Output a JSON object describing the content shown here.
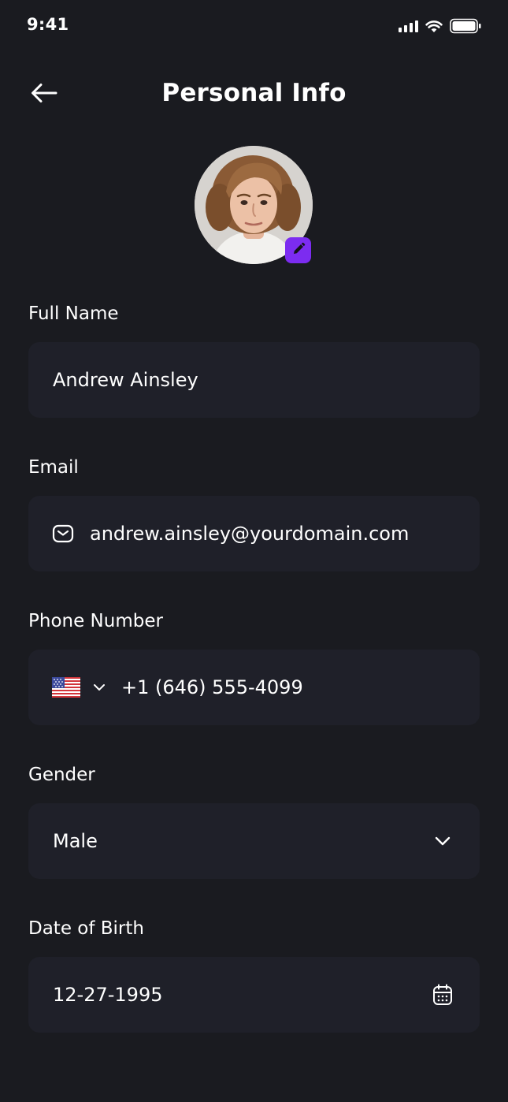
{
  "status_bar": {
    "time": "9:41",
    "icons": [
      "signal-icon",
      "wifi-icon",
      "battery-icon"
    ]
  },
  "header": {
    "back_icon": "arrow-left-icon",
    "title": "Personal Info"
  },
  "profile": {
    "avatar": "profile-photo",
    "edit_icon": "pencil-icon",
    "accent_color": "#7c2cf0"
  },
  "form": {
    "full_name": {
      "label": "Full Name",
      "value": "Andrew Ainsley"
    },
    "email": {
      "label": "Email",
      "value": "andrew.ainsley@yourdomain.com",
      "icon": "mail-icon"
    },
    "phone": {
      "label": "Phone Number",
      "value": "+1 (646) 555-4099",
      "country_flag": "us-flag-icon",
      "dropdown_icon": "chevron-down-icon"
    },
    "gender": {
      "label": "Gender",
      "value": "Male",
      "icon": "chevron-down-icon"
    },
    "date_of_birth": {
      "label": "Date of Birth",
      "value": "12-27-1995",
      "icon": "calendar-icon"
    }
  },
  "colors": {
    "background": "#1a1b20",
    "field_background": "#1f2029",
    "text": "#ffffff"
  }
}
